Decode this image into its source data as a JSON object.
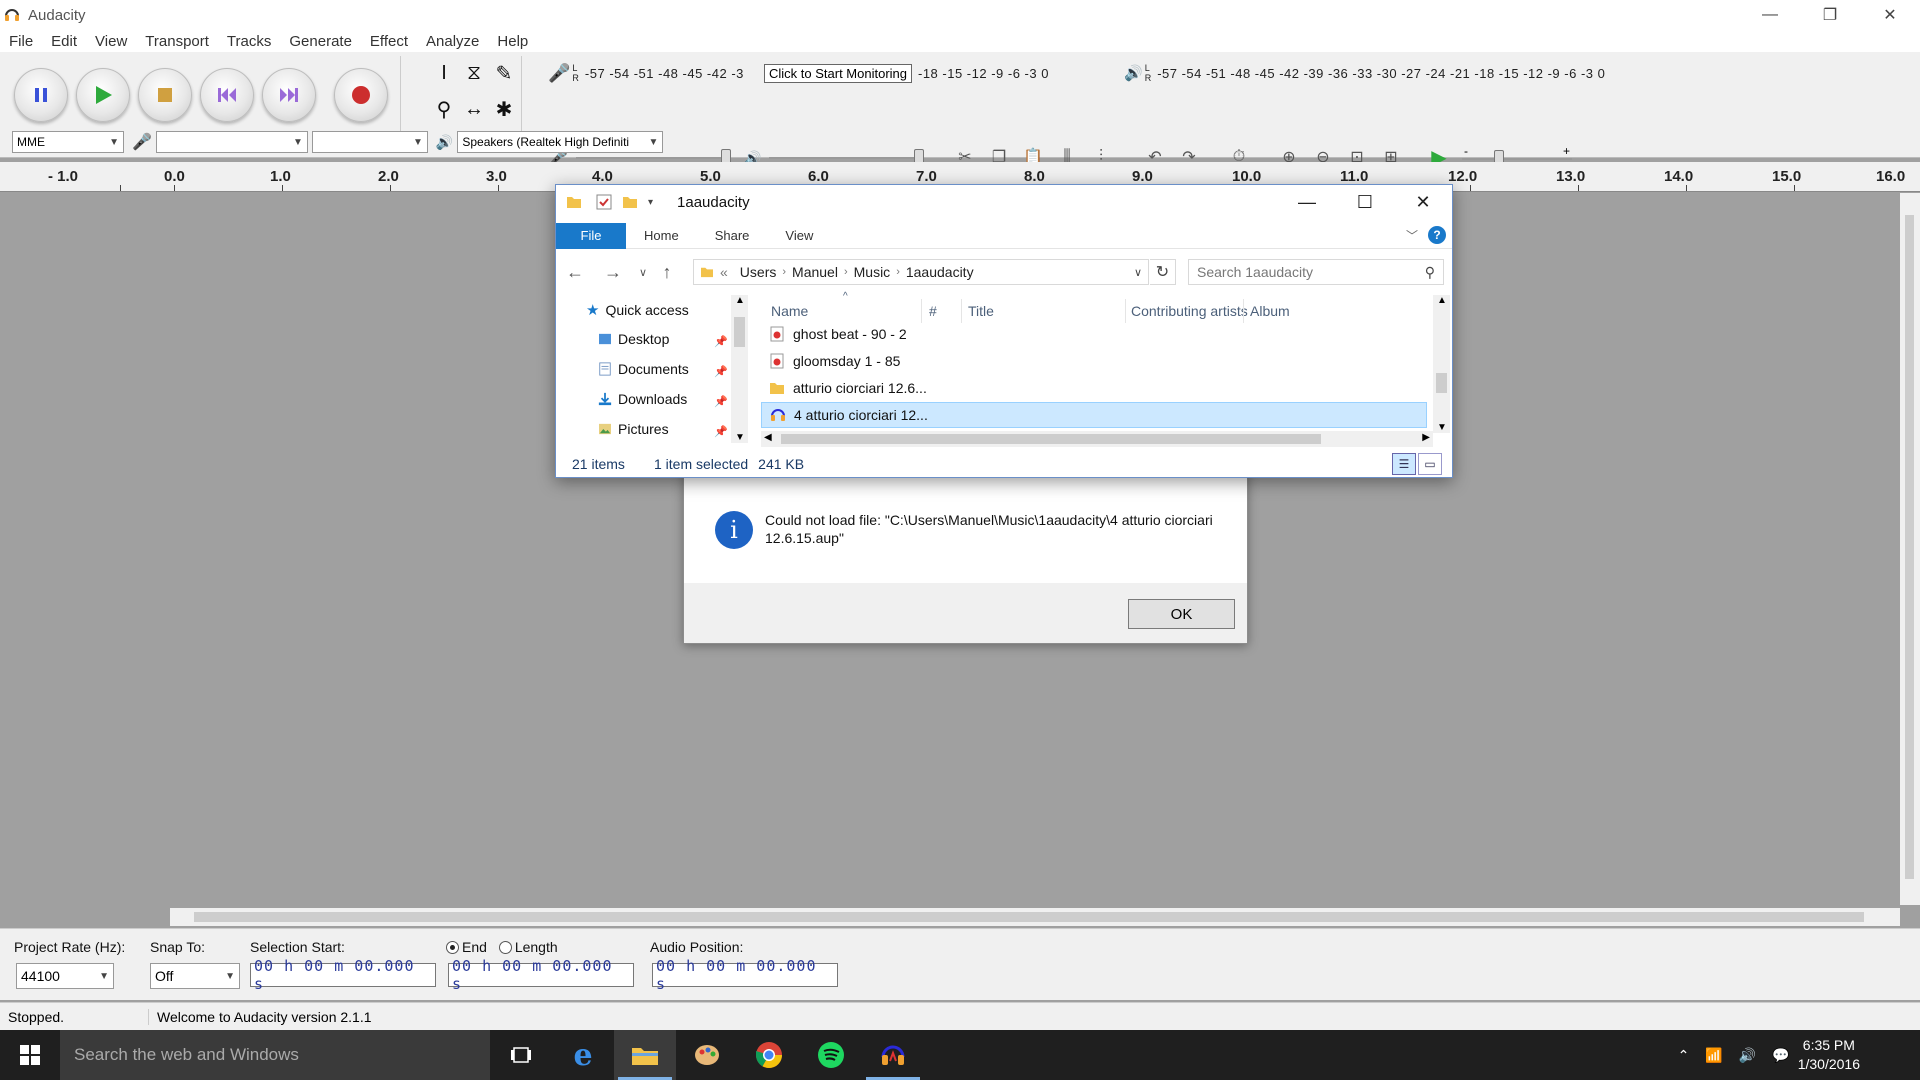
{
  "app": {
    "title": "Audacity",
    "window_controls": [
      "—",
      "❐",
      "✕"
    ]
  },
  "menu": [
    "File",
    "Edit",
    "View",
    "Transport",
    "Tracks",
    "Generate",
    "Effect",
    "Analyze",
    "Help"
  ],
  "toolbar": {
    "meter_scale_record": "-57 -54 -51 -48 -45 -42 -3",
    "meter_scale_record_tail": "-18 -15 -12  -9  -6  -3  0",
    "meter_scale_play": "-57 -54 -51 -48 -45 -42 -39 -36 -33 -30 -27 -24 -21 -18 -15 -12  -9  -6  -3  0",
    "meter_lr_top": "L",
    "meter_lr_bottom": "R",
    "tooltip": "Click to Start Monitoring",
    "host": "MME",
    "input_device": "",
    "input_channels": "",
    "output_device": "Speakers (Realtek High Definiti",
    "slider_minus": "-",
    "slider_plus": "+"
  },
  "ruler": {
    "labels": [
      "- 1.0",
      "0.0",
      "1.0",
      "2.0",
      "3.0",
      "4.0",
      "5.0",
      "6.0",
      "7.0",
      "8.0",
      "9.0",
      "10.0",
      "11.0",
      "12.0",
      "13.0",
      "14.0",
      "15.0",
      "16.0"
    ]
  },
  "selection": {
    "project_rate_label": "Project Rate (Hz):",
    "project_rate": "44100",
    "snap_label": "Snap To:",
    "snap": "Off",
    "sel_start_label": "Selection Start:",
    "end_label": "End",
    "length_label": "Length",
    "audio_pos_label": "Audio Position:",
    "time_value": "00 h 00 m 00.000 s"
  },
  "status": {
    "state": "Stopped.",
    "message": "Welcome to Audacity version 2.1.1"
  },
  "error_dialog": {
    "message": "Could not load file: \"C:\\Users\\Manuel\\Music\\1aaudacity\\4 atturio ciorciari 12.6.15.aup\"",
    "ok_label": "OK",
    "icon_glyph": "i"
  },
  "explorer": {
    "title": "1aaudacity",
    "ribbon_tabs": [
      "File",
      "Home",
      "Share",
      "View"
    ],
    "breadcrumb": [
      "Users",
      "Manuel",
      "Music",
      "1aaudacity"
    ],
    "breadcrumb_prefix": "«",
    "search_placeholder": "Search 1aaudacity",
    "nav_items": [
      {
        "label": "Quick access",
        "pinned": false
      },
      {
        "label": "Desktop",
        "pinned": true
      },
      {
        "label": "Documents",
        "pinned": true
      },
      {
        "label": "Downloads",
        "pinned": true
      },
      {
        "label": "Pictures",
        "pinned": true
      }
    ],
    "columns": [
      "Name",
      "#",
      "Title",
      "Contributing artists",
      "Album"
    ],
    "files": [
      {
        "name": "ghost beat  - 90 - 2",
        "type": "audio-file"
      },
      {
        "name": "gloomsday 1 - 85",
        "type": "audio-file"
      },
      {
        "name": "atturio ciorciari 12.6...",
        "type": "folder"
      },
      {
        "name": "4 atturio ciorciari 12...",
        "type": "audacity-project",
        "selected": true
      }
    ],
    "status_items": "21 items",
    "status_selected": "1 item selected",
    "status_size": "241 KB"
  },
  "taskbar": {
    "search_placeholder": "Search the web and Windows",
    "time": "6:35 PM",
    "date": "1/30/2016"
  },
  "colors": {
    "accent": "#1979ca",
    "selection": "#cce8ff",
    "track_bg": "#a0a0a0"
  }
}
